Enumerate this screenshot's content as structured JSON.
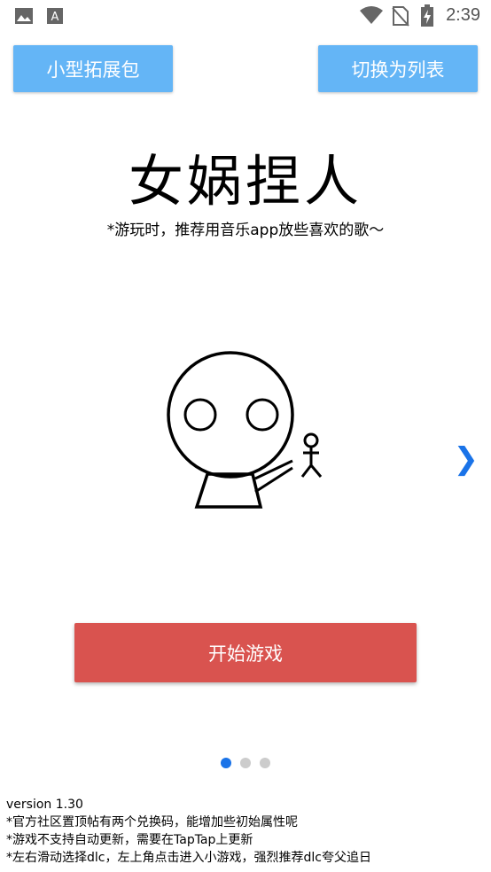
{
  "status_bar": {
    "time": "2:39",
    "icons": [
      "image-icon",
      "font-icon",
      "wifi-icon",
      "no-sim-icon",
      "battery-charging-icon"
    ]
  },
  "top_buttons": {
    "left_label": "小型拓展包",
    "right_label": "切换为列表"
  },
  "main": {
    "title": "女娲捏人",
    "subtitle": "*游玩时，推荐用音乐app放些喜欢的歌～",
    "next_arrow": "❯",
    "start_label": "开始游戏"
  },
  "pager": {
    "count": 3,
    "active_index": 0
  },
  "footer": {
    "lines": [
      "version 1.30",
      "*官方社区置顶帖有两个兑换码，能增加些初始属性呢",
      "*游戏不支持自动更新，需要在TapTap上更新",
      "*左右滑动选择dlc，左上角点击进入小游戏，强烈推荐dlc夸父追日"
    ]
  },
  "colors": {
    "top_button": "#64b5f6",
    "start_button": "#d9534f",
    "accent": "#1a73e8"
  }
}
